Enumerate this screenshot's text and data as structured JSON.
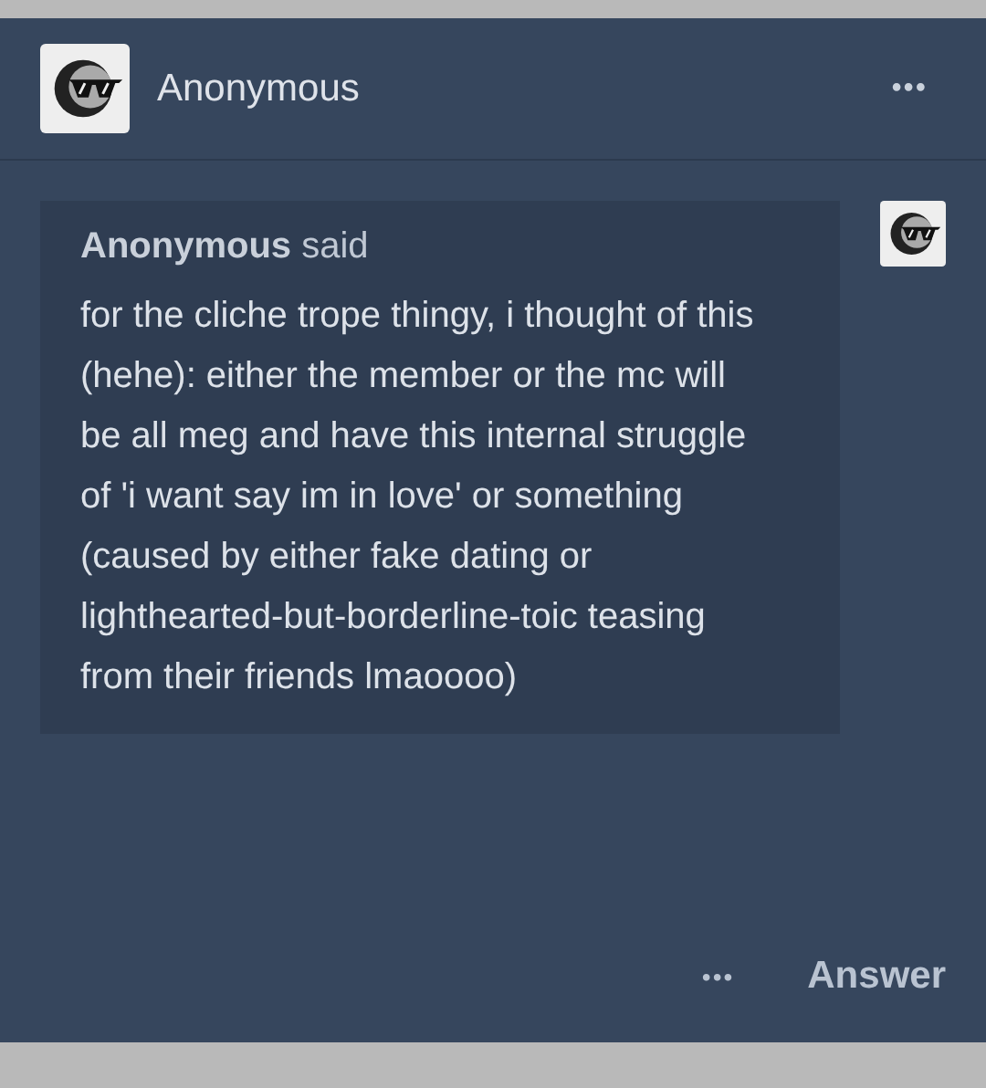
{
  "post": {
    "author": "Anonymous",
    "menu": "•••"
  },
  "ask": {
    "header": "**Anonymous** said",
    "body": "for the cliche trope thingy, i thought of this (hehe): either the member or the mc will be all meg and have this internal struggle of 'i want say im in love' or something (caused by either fake dating or lighthearted-but-borderline-toic teasing from their friends lmaoooo)"
  },
  "footer": {
    "more": "•••",
    "answer": "Answer"
  }
}
